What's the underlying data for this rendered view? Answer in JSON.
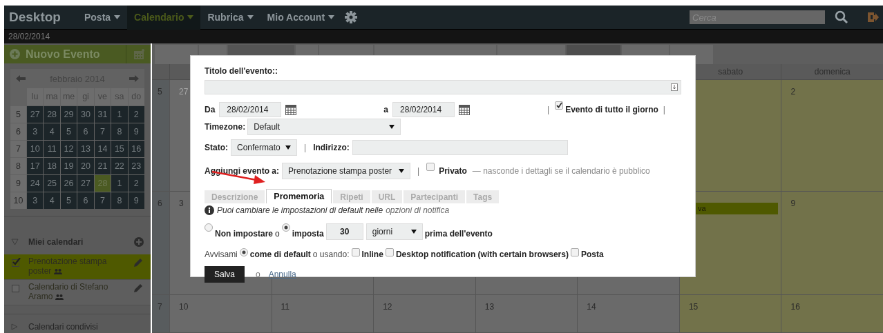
{
  "nav": {
    "logo": "Desktop",
    "menus": [
      {
        "label": "Posta",
        "selected": false
      },
      {
        "label": "Calendario",
        "selected": true
      },
      {
        "label": "Rubrica",
        "selected": false
      },
      {
        "label": "Mio Account",
        "selected": false
      }
    ],
    "search": {
      "placeholder": "Cerca"
    }
  },
  "date_bar": "28/02/2014",
  "sidebar": {
    "new_event": "Nuovo Evento",
    "mini_calendar": {
      "title": "febbraio 2014",
      "weekdays": [
        "lu",
        "ma",
        "me",
        "gi",
        "ve",
        "sa",
        "do"
      ],
      "weeks": [
        {
          "number": "5",
          "days": [
            {
              "label": "27",
              "selected": false
            },
            {
              "label": "28",
              "selected": false
            },
            {
              "label": "29",
              "selected": false
            },
            {
              "label": "30",
              "selected": false
            },
            {
              "label": "31",
              "selected": false
            },
            {
              "label": "1",
              "selected": false
            },
            {
              "label": "2",
              "selected": false
            }
          ]
        },
        {
          "number": "6",
          "days": [
            {
              "label": "3",
              "selected": false
            },
            {
              "label": "4",
              "selected": false
            },
            {
              "label": "5",
              "selected": false
            },
            {
              "label": "6",
              "selected": false
            },
            {
              "label": "7",
              "selected": false
            },
            {
              "label": "8",
              "selected": false
            },
            {
              "label": "9",
              "selected": false
            }
          ]
        },
        {
          "number": "7",
          "days": [
            {
              "label": "10",
              "selected": false
            },
            {
              "label": "11",
              "selected": false
            },
            {
              "label": "12",
              "selected": false
            },
            {
              "label": "13",
              "selected": false
            },
            {
              "label": "14",
              "selected": false
            },
            {
              "label": "15",
              "selected": false
            },
            {
              "label": "16",
              "selected": false
            }
          ]
        },
        {
          "number": "8",
          "days": [
            {
              "label": "17",
              "selected": false
            },
            {
              "label": "18",
              "selected": false
            },
            {
              "label": "19",
              "selected": false
            },
            {
              "label": "20",
              "selected": false
            },
            {
              "label": "21",
              "selected": false
            },
            {
              "label": "22",
              "selected": false
            },
            {
              "label": "23",
              "selected": false
            }
          ]
        },
        {
          "number": "9",
          "days": [
            {
              "label": "24",
              "selected": false
            },
            {
              "label": "25",
              "selected": false
            },
            {
              "label": "26",
              "selected": false
            },
            {
              "label": "27",
              "selected": false
            },
            {
              "label": "28",
              "selected": true
            },
            {
              "label": "1",
              "selected": false
            },
            {
              "label": "2",
              "selected": false
            }
          ]
        },
        {
          "number": "10",
          "days": [
            {
              "label": "3",
              "selected": false
            },
            {
              "label": "4",
              "selected": false
            },
            {
              "label": "5",
              "selected": false
            },
            {
              "label": "6",
              "selected": false
            },
            {
              "label": "7",
              "selected": false
            },
            {
              "label": "8",
              "selected": false
            },
            {
              "label": "9",
              "selected": false
            }
          ]
        }
      ]
    },
    "my_calendars": {
      "title": "Miei calendari",
      "expanded": true,
      "items": [
        {
          "label": "Prenotazione stampa poster",
          "checked": true,
          "selected": true
        },
        {
          "label": "Calendario di Stefano Aramo",
          "checked": false,
          "selected": false
        }
      ]
    },
    "shared_calendars": {
      "title": "Calendari condivisi",
      "expanded": false
    }
  },
  "toolbar": {
    "views": [
      {
        "selected": false
      },
      {
        "selected": false
      },
      {
        "selected": false
      },
      {
        "selected": true
      },
      {
        "selected": false
      },
      {
        "selected": false
      }
    ]
  },
  "month_grid": {
    "visible_headers": [
      "sabato",
      "domenica"
    ],
    "weeks": [
      {
        "number": "5",
        "days": [
          {
            "label": "27",
            "other_month": true,
            "weekend": false
          },
          {
            "weekend": true
          },
          {
            "label": "2",
            "other_month": false,
            "weekend": true
          }
        ]
      },
      {
        "number": "6",
        "days": [
          {
            "label": "3",
            "other_month": false,
            "weekend": false
          },
          {
            "weekend": false
          },
          {
            "weekend": false
          },
          {
            "weekend": false
          },
          {
            "weekend": false
          },
          {
            "weekend": true,
            "events": [
              "va"
            ]
          },
          {
            "label": "9",
            "other_month": false,
            "weekend": true
          }
        ]
      },
      {
        "number": "7",
        "days": [
          {
            "label": "10",
            "other_month": false,
            "weekend": false
          },
          {
            "label": "11",
            "other_month": false,
            "weekend": false
          },
          {
            "label": "12",
            "other_month": false,
            "weekend": false
          },
          {
            "label": "13",
            "other_month": false,
            "weekend": false
          },
          {
            "label": "14",
            "other_month": false,
            "weekend": false
          },
          {
            "label": "15",
            "other_month": false,
            "weekend": true
          },
          {
            "label": "16",
            "other_month": false,
            "weekend": true
          }
        ]
      }
    ]
  },
  "dialog": {
    "title_label": "Titolo dell'evento::",
    "from_label": "Da",
    "from_date": "28/02/2014",
    "to_label": "a",
    "to_date": "28/02/2014",
    "separator_1": "|",
    "all_day": {
      "label": "Evento di tutto il giorno",
      "checked": true
    },
    "separator_2": "|",
    "timezone_label": "Timezone:",
    "timezone": "Default",
    "status_label": "Stato:",
    "status": "Confermato",
    "separator_3": "|",
    "address_label": "Indirizzo:",
    "add_to_label": "Aggiungi evento a:",
    "add_to": "Prenotazione stampa poster",
    "separator_4": "|",
    "private": {
      "label": "Privato",
      "checked": false
    },
    "private_hint": "— nasconde i dettagli se il calendario è pubblico",
    "tabs": [
      {
        "label": "Descrizione",
        "selected": false
      },
      {
        "label": "Promemoria",
        "selected": true
      },
      {
        "label": "Ripeti",
        "selected": false
      },
      {
        "label": "URL",
        "selected": false
      },
      {
        "label": "Partecipanti",
        "selected": false
      },
      {
        "label": "Tags",
        "selected": false
      }
    ],
    "info_text": "Puoi cambiare le impostazioni di default nelle",
    "info_link": "opzioni di notifica",
    "reminder": {
      "none": {
        "label": "Non impostare",
        "selected": false
      },
      "or": "o",
      "set": {
        "label": "imposta",
        "selected": true
      },
      "amount": "30",
      "unit": "giorni",
      "after": "prima dell'evento"
    },
    "notify": {
      "label": "Avvisami",
      "default": {
        "label": "come di default",
        "selected": true
      },
      "or_using": "o usando:",
      "options": [
        {
          "label": "Inline",
          "checked": false
        },
        {
          "label": "Desktop notification (with certain browsers)",
          "checked": false
        },
        {
          "label": "Posta",
          "checked": false
        }
      ]
    },
    "save": "Salva",
    "or": "o",
    "cancel": "Annulla"
  }
}
